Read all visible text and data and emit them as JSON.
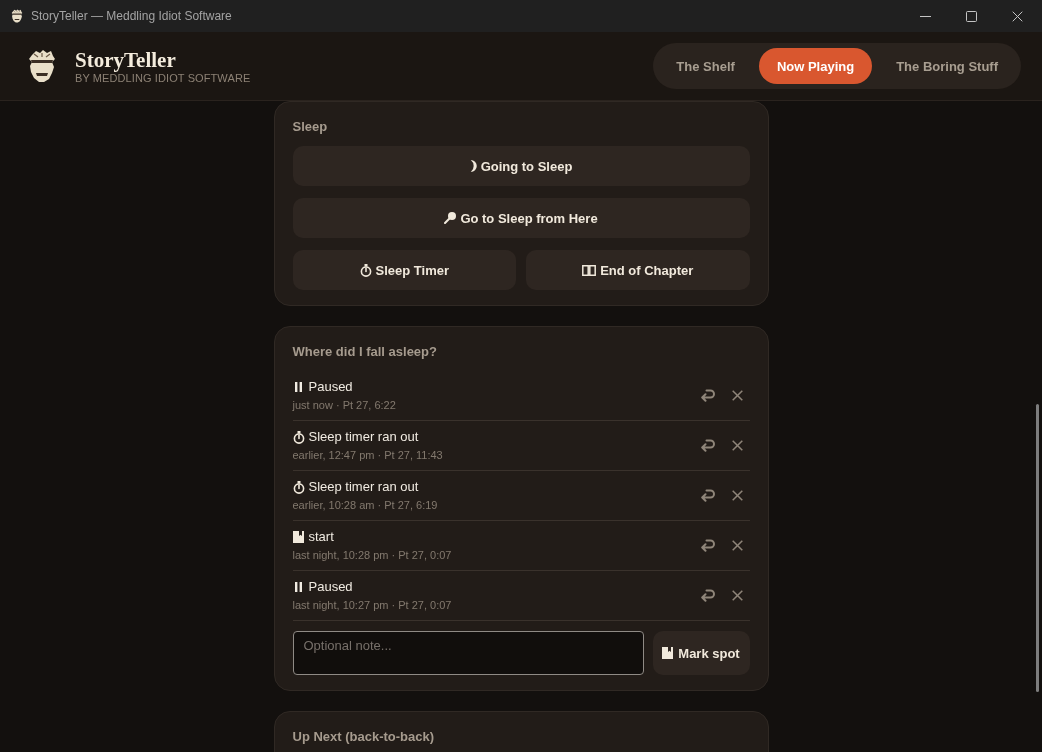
{
  "window": {
    "title": "StoryTeller — Meddling Idiot Software"
  },
  "header": {
    "app_name": "StoryTeller",
    "tagline": "BY MEDDLING IDIOT SOFTWARE"
  },
  "nav_tabs": [
    {
      "label": "The Shelf",
      "selected": false
    },
    {
      "label": "Now Playing",
      "selected": true
    },
    {
      "label": "The Boring Stuff",
      "selected": false
    }
  ],
  "sleep": {
    "title": "Sleep",
    "button_rows": [
      [
        {
          "kind": "now",
          "label": "Going to Sleep"
        }
      ],
      [
        {
          "kind": "here",
          "label": "Go to Sleep from Here"
        }
      ],
      [
        {
          "kind": "timer",
          "label": "Sleep Timer"
        },
        {
          "kind": "chapter",
          "label": "End of Chapter"
        }
      ]
    ]
  },
  "history": {
    "title": "Where did I fall asleep?",
    "entries": [
      {
        "kind": "paused",
        "label": "Paused",
        "meta": "just now · Pt 27, 6:22"
      },
      {
        "kind": "timer",
        "label": "Sleep timer ran out",
        "meta": "earlier, 12:47 pm · Pt 27, 11:43"
      },
      {
        "kind": "timer",
        "label": "Sleep timer ran out",
        "meta": "earlier, 10:28 am · Pt 27, 6:19"
      },
      {
        "kind": "mark",
        "label": "start",
        "meta": "last night, 10:28 pm · Pt 27, 0:07"
      },
      {
        "kind": "paused",
        "label": "Paused",
        "meta": "last night, 10:27 pm · Pt 27, 0:07"
      }
    ],
    "note": {
      "placeholder": "Optional note..."
    },
    "mark_button": {
      "label": "Mark spot"
    }
  },
  "up_next": {
    "title": "Up Next (back-to-back)"
  }
}
